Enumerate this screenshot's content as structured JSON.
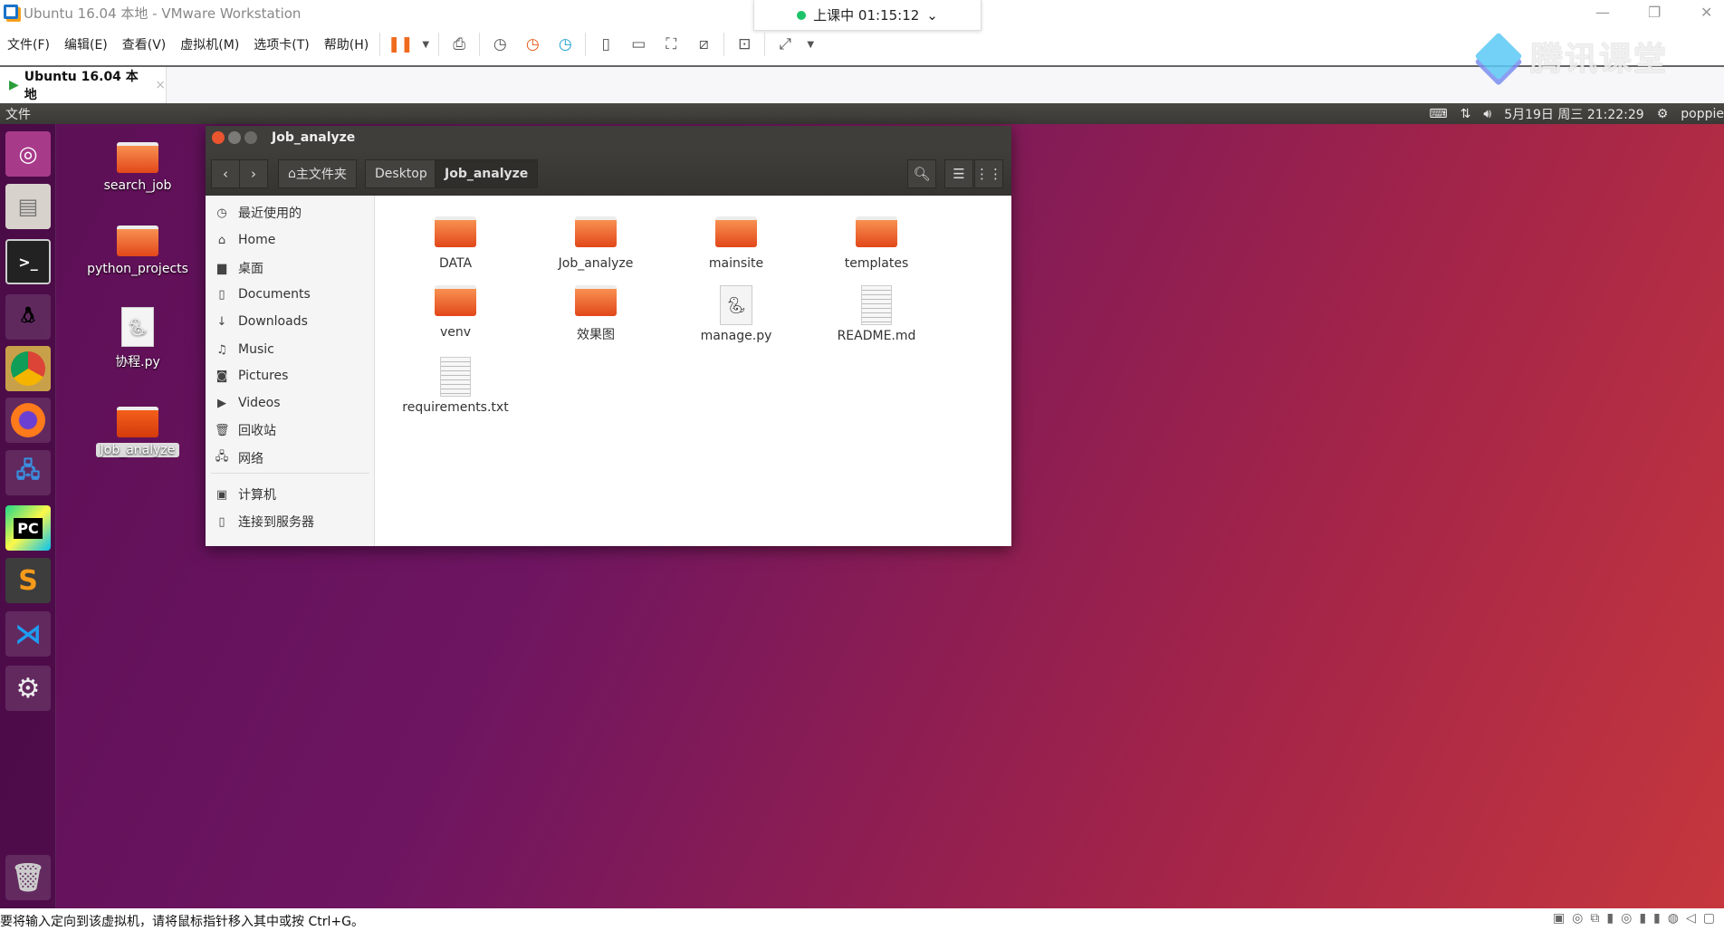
{
  "vmware": {
    "title": "Ubuntu 16.04 本地 - VMware Workstation",
    "menu": [
      "文件(F)",
      "编辑(E)",
      "查看(V)",
      "虚拟机(M)",
      "选项卡(T)",
      "帮助(H)"
    ],
    "tab": "Ubuntu 16.04 本地",
    "status": "要将输入定向到该虚拟机，请将鼠标指针移入其中或按 Ctrl+G。"
  },
  "live": {
    "label": "上课中 01:15:12"
  },
  "watermark": "腾讯课堂",
  "panel": {
    "app": "文件",
    "datetime": "5月19日 周三 21:22:29",
    "user": "poppie"
  },
  "launcher": [
    "ubuntu-dash",
    "files",
    "terminal",
    "qq",
    "chrome",
    "firefox",
    "network",
    "pycharm",
    "sublime",
    "vscode",
    "settings",
    "trash"
  ],
  "desktop": [
    {
      "name": "search_job",
      "type": "folder"
    },
    {
      "name": "python_projects",
      "type": "folder"
    },
    {
      "name": "协程.py",
      "type": "python"
    },
    {
      "name": "Job_analyze",
      "type": "folder",
      "selected": true
    }
  ],
  "fm": {
    "title": "Job_analyze",
    "breadcrumb": [
      "主文件夹",
      "Desktop",
      "Job_analyze"
    ],
    "sidebar": [
      "最近使用的",
      "Home",
      "桌面",
      "Documents",
      "Downloads",
      "Music",
      "Pictures",
      "Videos",
      "回收站",
      "网络",
      "计算机",
      "连接到服务器"
    ],
    "files": [
      {
        "name": "DATA",
        "type": "folder"
      },
      {
        "name": "Job_analyze",
        "type": "folder"
      },
      {
        "name": "mainsite",
        "type": "folder"
      },
      {
        "name": "templates",
        "type": "folder"
      },
      {
        "name": "venv",
        "type": "folder"
      },
      {
        "name": "效果图",
        "type": "folder"
      },
      {
        "name": "manage.py",
        "type": "python"
      },
      {
        "name": "README.md",
        "type": "text"
      },
      {
        "name": "requirements.txt",
        "type": "text"
      }
    ]
  }
}
